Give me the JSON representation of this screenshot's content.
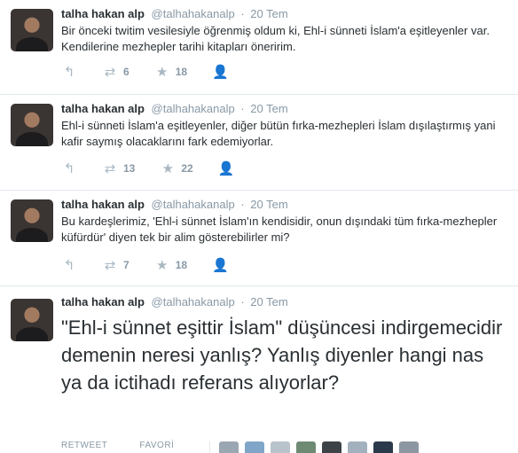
{
  "tweets": [
    {
      "name": "talha hakan alp",
      "handle": "@talhahakanalp",
      "separator": "·",
      "time": "20 Tem",
      "text": "Bir önceki twitim vesilesiyle öğrenmiş oldum ki, Ehl-i sünneti İslam'a eşitleyenler var. Kendilerine mezhepler tarihi kitapları öneririm.",
      "retweets": "6",
      "favorites": "18"
    },
    {
      "name": "talha hakan alp",
      "handle": "@talhahakanalp",
      "separator": "·",
      "time": "20 Tem",
      "text": "Ehl-i sünneti İslam'a eşitleyenler, diğer bütün fırka-mezhepleri İslam dışılaştırmış yani kafir saymış olacaklarını fark edemiyorlar.",
      "retweets": "13",
      "favorites": "22"
    },
    {
      "name": "talha hakan alp",
      "handle": "@talhahakanalp",
      "separator": "·",
      "time": "20 Tem",
      "text": "Bu kardeşlerimiz, 'Ehl-i sünnet İslam'ın kendisidir, onun dışındaki tüm fırka-mezhepler küfürdür' diyen tek bir alim gösterebilirler mi?",
      "retweets": "7",
      "favorites": "18"
    }
  ],
  "expanded": {
    "name": "talha hakan alp",
    "handle": "@talhahakanalp",
    "separator": "·",
    "time": "20 Tem",
    "text": "\"Ehl-i sünnet eşittir İslam\" düşüncesi indirgemecidir demenin neresi yanlış? Yanlış diyenler hangi nas ya da ictihadı referans alıyorlar?",
    "retweet_label": "RETWEET",
    "favorite_label": "FAVORİ"
  },
  "icons": {
    "reply": "reply-icon",
    "retweet": "retweet-icon",
    "favorite": "star-icon",
    "follow": "follow-icon"
  },
  "colors": {
    "text": "#292f33",
    "muted": "#8899a6",
    "icon": "#aab8c2",
    "divider": "#e1e8ed"
  }
}
